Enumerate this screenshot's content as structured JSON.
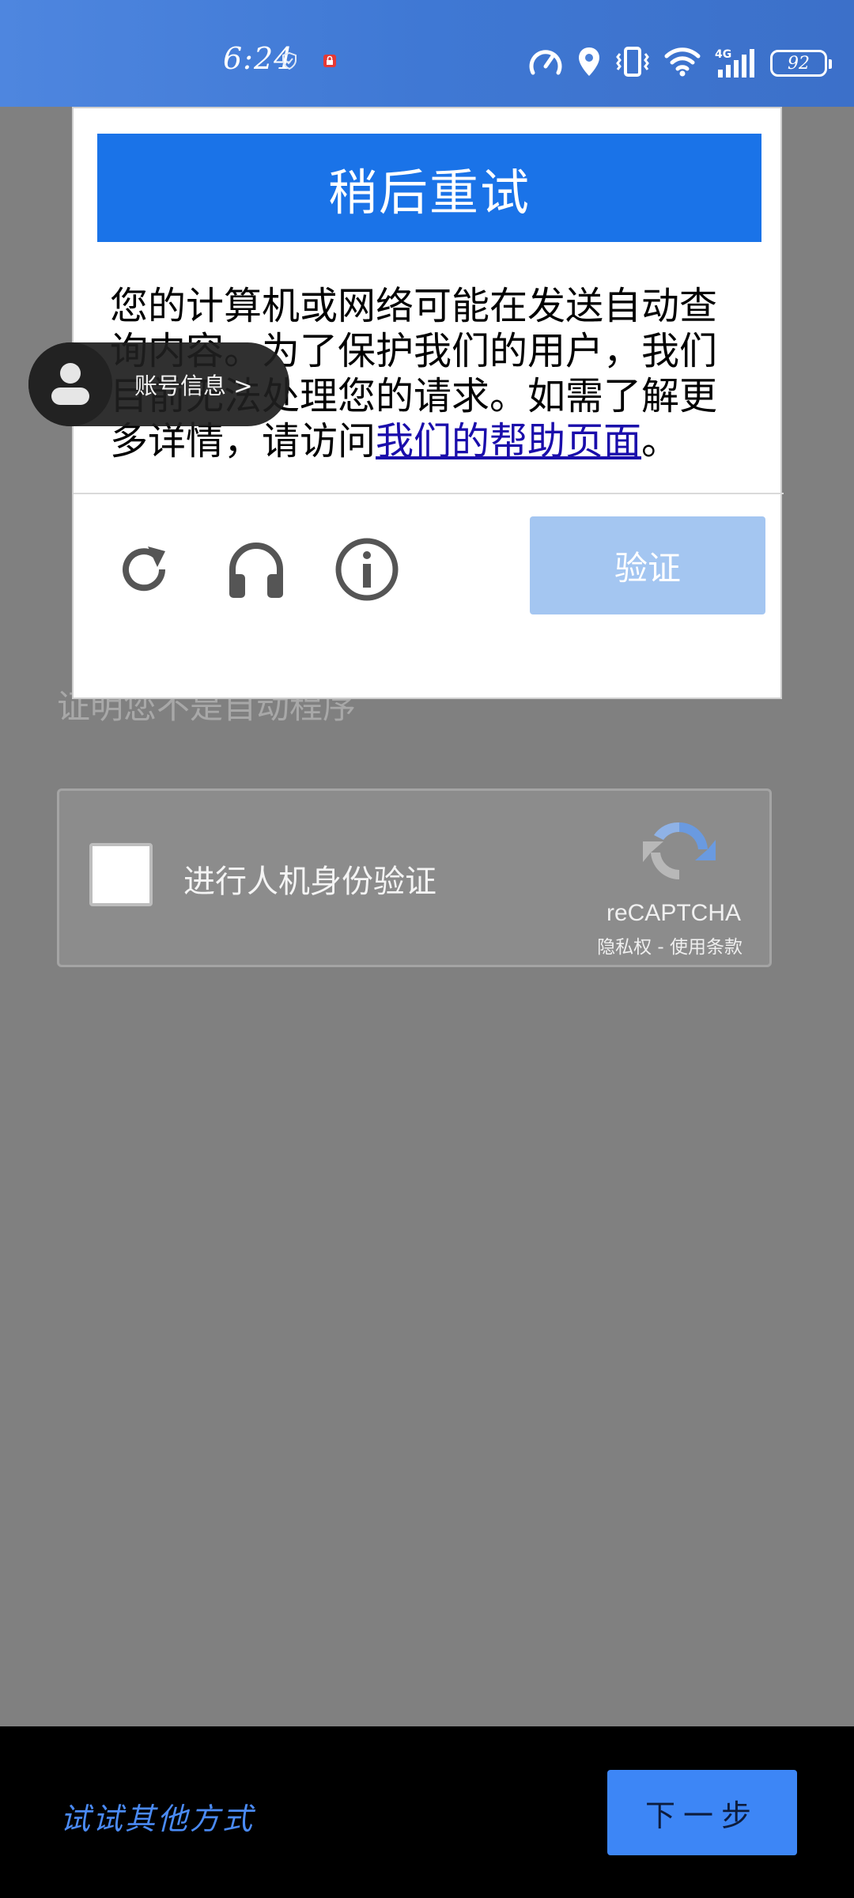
{
  "status_bar": {
    "time": "6:24",
    "network": "4G",
    "battery": "92",
    "icons": [
      "shield-icon",
      "lock-notification-icon",
      "speed-icon",
      "location-icon",
      "vibrate-icon",
      "wifi-icon",
      "signal-icon",
      "battery-icon"
    ]
  },
  "dialog": {
    "title": "稍后重试",
    "message_prefix": "您的计算机或网络可能在发送自动查询内容。为了保护我们的用户，我们目前无法处理您的请求。如需了解更多详情，请访问",
    "help_link": "我们的帮助页面",
    "message_suffix": "。",
    "verify_button": "验证",
    "tools": [
      "reload-icon",
      "audio-headphones-icon",
      "info-icon"
    ]
  },
  "account_bubble": {
    "label": "账号信息 >"
  },
  "background": {
    "heading": "证明您不是自动程序",
    "checkbox_label": "进行人机身份验证",
    "brand": "reCAPTCHA",
    "terms": "隐私权 - 使用条款"
  },
  "bottom": {
    "other_methods": "试试其他方式",
    "next_button": "下一步"
  },
  "colors": {
    "header_blue": "#1a73e8",
    "verify_disabled": "#a4c6f1",
    "next_blue": "#3d86f6",
    "link_color": "#1a0dab"
  }
}
